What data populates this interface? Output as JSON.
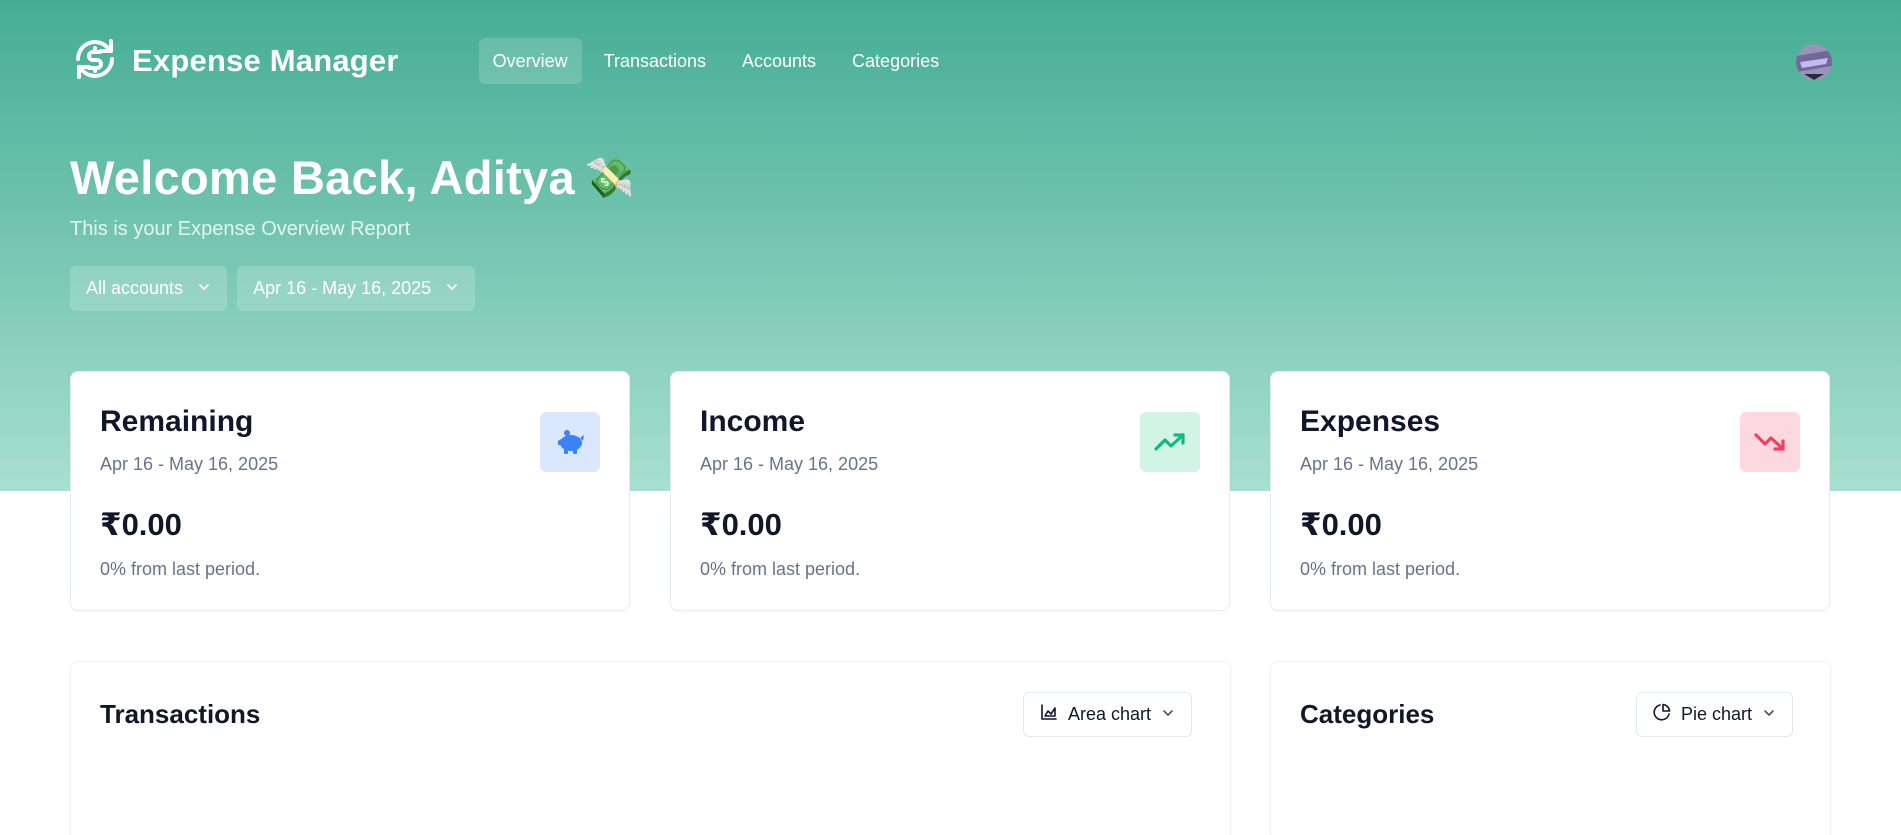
{
  "app": {
    "title": "Expense Manager"
  },
  "nav": {
    "items": [
      {
        "label": "Overview",
        "active": true
      },
      {
        "label": "Transactions"
      },
      {
        "label": "Accounts"
      },
      {
        "label": "Categories"
      }
    ]
  },
  "hero": {
    "welcome": "Welcome Back, Aditya",
    "emoji": "💸",
    "subtitle": "This is your Expense Overview Report"
  },
  "filters": {
    "account": "All accounts",
    "date_range": "Apr 16 - May 16, 2025"
  },
  "cards": [
    {
      "title": "Remaining",
      "date": "Apr 16 - May 16, 2025",
      "value": "₹0.00",
      "change": "0% from last period.",
      "icon": "piggy-bank-icon",
      "icon_bg": "#dbe7fd",
      "icon_color": "#3b82f6"
    },
    {
      "title": "Income",
      "date": "Apr 16 - May 16, 2025",
      "value": "₹0.00",
      "change": "0% from last period.",
      "icon": "trending-up-icon",
      "icon_bg": "#d1f4e5",
      "icon_color": "#10b981"
    },
    {
      "title": "Expenses",
      "date": "Apr 16 - May 16, 2025",
      "value": "₹0.00",
      "change": "0% from last period.",
      "icon": "trending-down-icon",
      "icon_bg": "#fdd8de",
      "icon_color": "#f43f5e"
    }
  ],
  "panels": {
    "transactions": {
      "title": "Transactions",
      "chart_select": "Area chart"
    },
    "categories": {
      "title": "Categories",
      "chart_select": "Pie chart"
    }
  },
  "colors": {
    "hero_top": "#45ad95",
    "hero_bottom": "#a8e0cf"
  }
}
